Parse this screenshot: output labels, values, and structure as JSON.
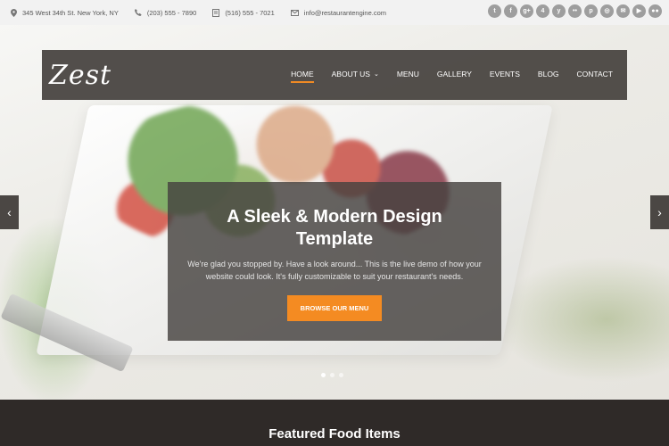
{
  "topbar": {
    "address": "345 West 34th St. New York, NY",
    "phone": "(203) 555 - 7890",
    "fax": "(516) 555 - 7021",
    "email": "info@restaurantengine.com"
  },
  "social": [
    {
      "name": "twitter",
      "glyph": "t"
    },
    {
      "name": "facebook",
      "glyph": "f"
    },
    {
      "name": "google-plus",
      "glyph": "g+"
    },
    {
      "name": "foursquare",
      "glyph": "4"
    },
    {
      "name": "yelp",
      "glyph": "y"
    },
    {
      "name": "flickr-dots",
      "glyph": "••"
    },
    {
      "name": "pinterest",
      "glyph": "p"
    },
    {
      "name": "instagram",
      "glyph": "◎"
    },
    {
      "name": "email",
      "glyph": "✉"
    },
    {
      "name": "youtube",
      "glyph": "▶"
    },
    {
      "name": "flickr",
      "glyph": "●●"
    }
  ],
  "header": {
    "logo": "Zest",
    "nav": [
      "HOME",
      "ABOUT US",
      "MENU",
      "GALLERY",
      "EVENTS",
      "BLOG",
      "CONTACT"
    ],
    "active": "HOME"
  },
  "hero": {
    "title": "A Sleek & Modern Design Template",
    "text": "We're glad you stopped by.  Have a look around...  This is the live demo of how your website could look.  It's fully customizable to suit your restaurant's needs.",
    "button": "BROWSE OUR MENU",
    "slides": 3,
    "current_slide": 1
  },
  "featured": {
    "title": "Featured Food Items"
  },
  "colors": {
    "accent": "#f48b22",
    "nav_bg": "#4b4744",
    "dark_section": "#2f2a28"
  }
}
